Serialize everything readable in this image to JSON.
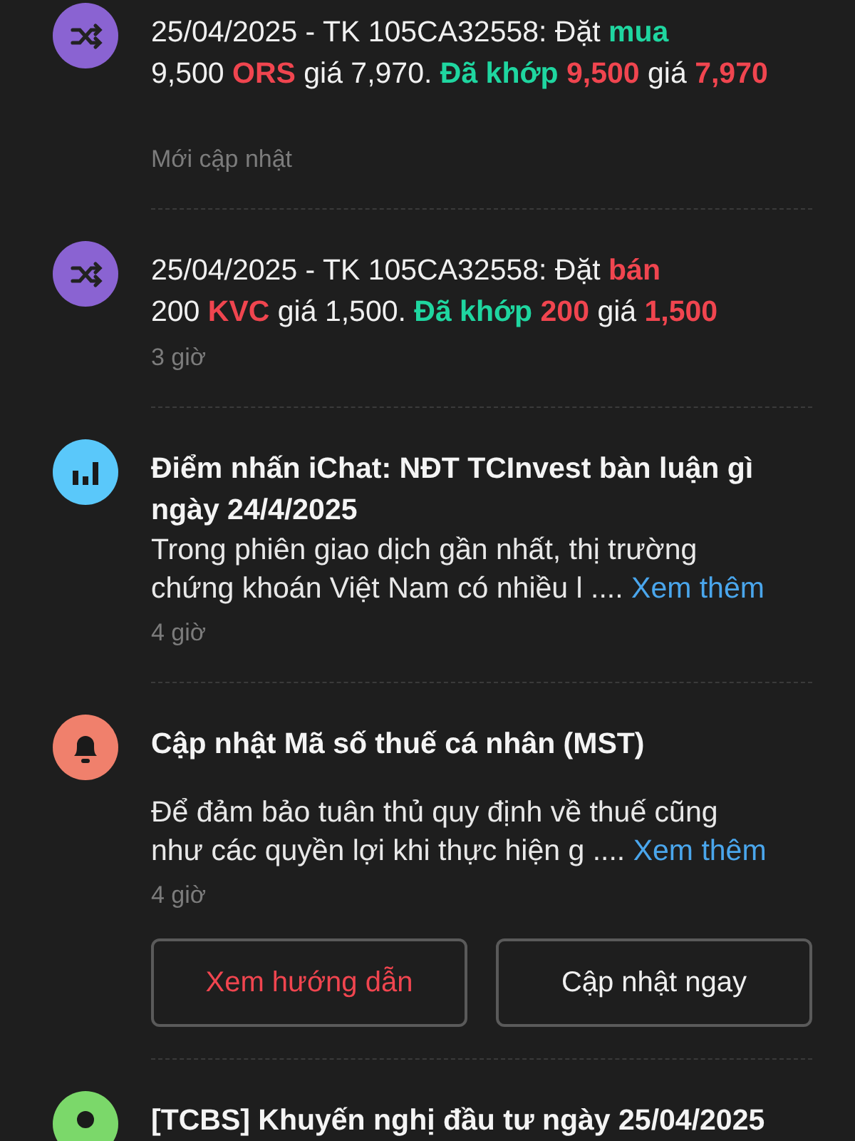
{
  "notifications": [
    {
      "kind": "order",
      "color": "#8a63d2",
      "lines": [
        [
          {
            "text": "25/04/2025 - TK 105CA32558: Đặt "
          },
          {
            "text": "mua",
            "color": "#1fd6a0"
          }
        ],
        [
          {
            "text": "9,500 "
          },
          {
            "text": "ORS",
            "color": "#f0454f"
          },
          {
            "text": " giá 7,970. "
          },
          {
            "text": "Đã khớp ",
            "color": "#1fd6a0"
          },
          {
            "text": "9,500",
            "color": "#f0454f"
          },
          {
            "text": " giá "
          },
          {
            "text": "7,970",
            "color": "#f0454f"
          }
        ]
      ],
      "time": "Mới cập nhật"
    },
    {
      "kind": "order",
      "color": "#8a63d2",
      "lines": [
        [
          {
            "text": "25/04/2025 - TK 105CA32558: Đặt "
          },
          {
            "text": "bán",
            "color": "#f0454f"
          }
        ],
        [
          {
            "text": "200 "
          },
          {
            "text": "KVC",
            "color": "#f0454f"
          },
          {
            "text": " giá 1,500. "
          },
          {
            "text": "Đã khớp ",
            "color": "#1fd6a0"
          },
          {
            "text": "200",
            "color": "#f0454f"
          },
          {
            "text": " giá "
          },
          {
            "text": "1,500",
            "color": "#f0454f"
          }
        ]
      ],
      "time": "3 giờ"
    },
    {
      "kind": "insight",
      "color": "#5ac8fa",
      "title": "Điểm nhấn iChat: NĐT TCInvest bàn luận gì ngày 24/4/2025",
      "body_lines": [
        "Trong phiên giao dịch gần nhất, thị trường",
        "chứng khoán Việt Nam có nhiều l"
      ],
      "ellipsis": "....",
      "more": "Xem thêm",
      "time": "4 giờ"
    },
    {
      "kind": "alert",
      "color": "#f0806c",
      "title": "Cập nhật Mã số thuế cá nhân (MST)",
      "body_lines": [
        "Để đảm bảo tuân thủ quy định về thuế cũng",
        "như các quyền lợi khi thực hiện g"
      ],
      "ellipsis": "....",
      "more": "Xem thêm",
      "time": "4 giờ",
      "actions": [
        {
          "label": "Xem hướng dẫn",
          "color": "#f0454f"
        },
        {
          "label": "Cập nhật ngay",
          "color": "#f0f0f0"
        }
      ]
    },
    {
      "kind": "advice",
      "color": "#7bd86a",
      "title": "[TCBS] Khuyến nghị đầu tư ngày 25/04/2025"
    }
  ]
}
